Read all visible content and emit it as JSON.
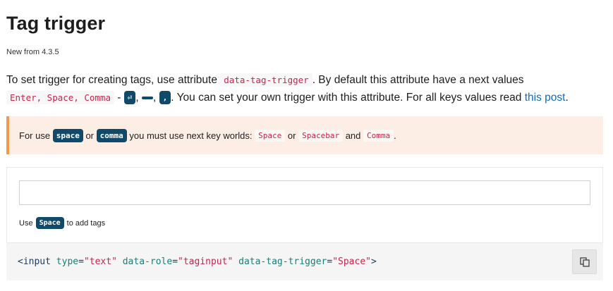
{
  "title": "Tag trigger",
  "subtitle": "New from 4.3.5",
  "paragraph": {
    "text1": "To set trigger for creating tags, use attribute ",
    "attr_code": "data-tag-trigger",
    "text2": ". By default this attribute have a next values",
    "values_code": "Enter, Space, Comma",
    "dash": " - ",
    "key_enter": "⏎",
    "key_space": " ",
    "key_comma": ",",
    "comma_sep": ", ",
    "text3": ". You can set your own trigger with this attribute. For all keys values read ",
    "link_text": "this post",
    "end": "."
  },
  "alert": {
    "for_use": "For use",
    "kbd_space": "space",
    "or": "or",
    "kbd_comma": "comma",
    "must_use": "you must use next key worlds:",
    "code_space": "Space",
    "or2": "or",
    "code_spacebar": "Spacebar",
    "and": "and",
    "code_comma": "Comma",
    "end": "."
  },
  "demo": {
    "input_value": "",
    "hint_use": "Use",
    "hint_key": "Space",
    "hint_rest": "to add tags"
  },
  "code": {
    "open": "<input",
    "attr1": "type",
    "val1": "\"text\"",
    "attr2": "data-role",
    "val2": "\"taginput\"",
    "attr3": "data-tag-trigger",
    "val3": "\"Space\"",
    "close": ">",
    "eq": "="
  },
  "icons": {
    "copy": "copy-icon"
  },
  "colors": {
    "kbd_bg": "#0f4a6b",
    "alert_bg": "#fdeee5",
    "alert_border": "#f2994a",
    "link": "#0f6cbd",
    "code_string": "#c7254e"
  }
}
